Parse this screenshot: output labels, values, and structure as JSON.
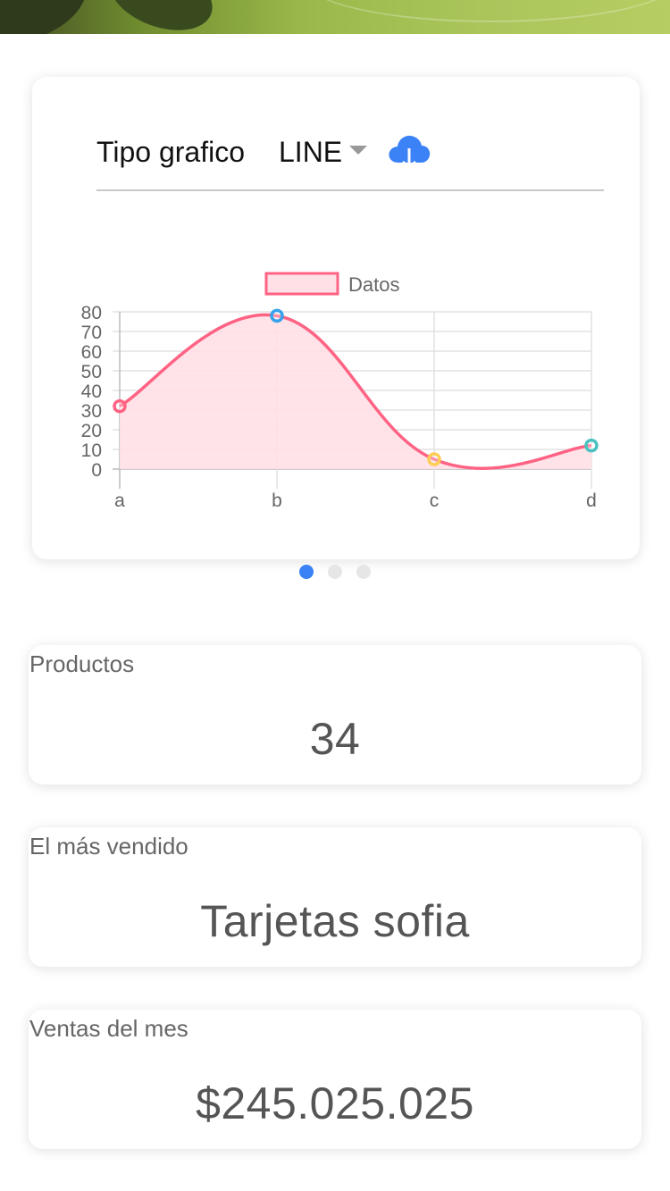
{
  "chart_selector": {
    "label": "Tipo grafico",
    "selected": "LINE",
    "download_icon": "cloud-download-icon"
  },
  "chart_data": {
    "type": "line",
    "categories": [
      "a",
      "b",
      "c",
      "d"
    ],
    "series": [
      {
        "name": "Datos",
        "values": [
          32,
          78,
          5,
          12
        ]
      }
    ],
    "point_colors": [
      "#ff6384",
      "#36a2eb",
      "#ffcd56",
      "#4bc0c0"
    ],
    "line_color": "#ff6384",
    "fill_color": "#ffe0e6",
    "ylim": [
      0,
      80
    ],
    "yticks": [
      0,
      10,
      20,
      30,
      40,
      50,
      60,
      70,
      80
    ],
    "grid": true,
    "legend": "top"
  },
  "carousel": {
    "pages": 3,
    "active": 0
  },
  "stats": [
    {
      "label": "Productos",
      "value": "34"
    },
    {
      "label": "El más vendido",
      "value": "Tarjetas sofia"
    },
    {
      "label": "Ventas del mes",
      "value": "$245.025.025"
    }
  ]
}
